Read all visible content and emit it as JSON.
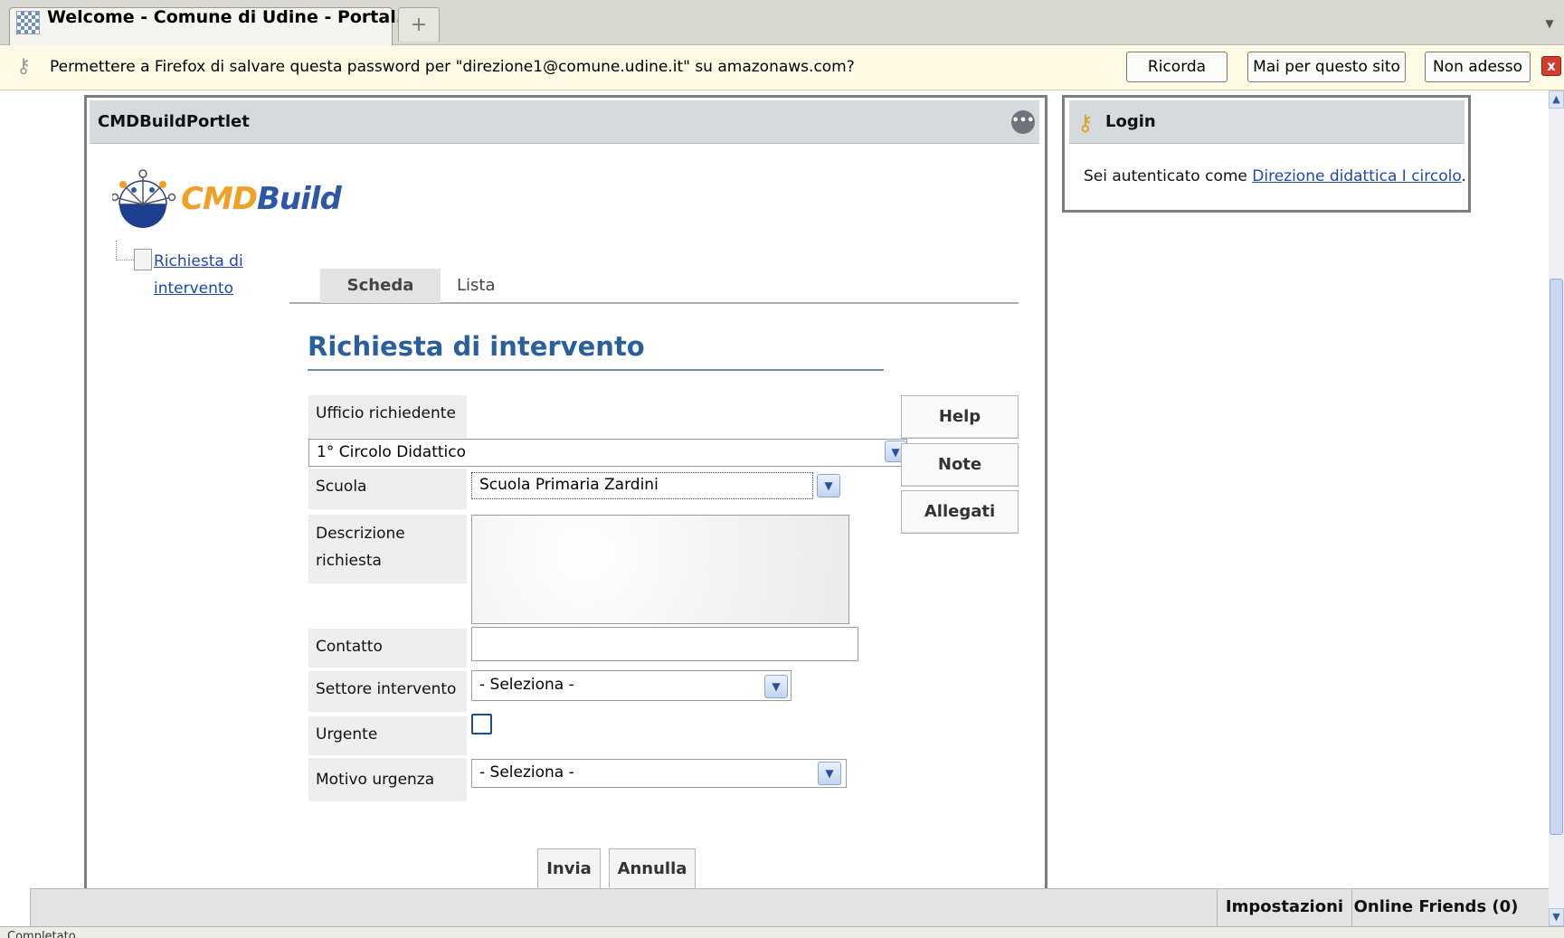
{
  "browser": {
    "tab_title": "Welcome - Comune di Udine - Portal...",
    "new_tab_symbol": "+",
    "notification": {
      "text": "Permettere a Firefox di salvare questa password per \"direzione1@comune.udine.it\" su amazonaws.com?",
      "buttons": [
        "Ricorda",
        "Mai per questo sito",
        "Non adesso"
      ],
      "close_symbol": "x"
    },
    "status_text": "Completato"
  },
  "cmdbuild_portlet": {
    "title": "CMDBuildPortlet",
    "logo_part1": "CMD",
    "logo_part2": "Build",
    "tree_item": "Richiesta di intervento",
    "tabs": [
      "Scheda",
      "Lista"
    ],
    "active_tab": "Scheda",
    "form": {
      "title": "Richiesta di intervento",
      "ufficio_label": "Ufficio richiedente",
      "ufficio_value": "1° Circolo Didattico",
      "scuola_label": "Scuola",
      "scuola_value": "Scuola Primaria Zardini",
      "descrizione_label": "Descrizione richiesta",
      "descrizione_value": "",
      "contatto_label": "Contatto",
      "contatto_value": "",
      "settore_label": "Settore intervento",
      "settore_value": "- Seleziona -",
      "urgente_label": "Urgente",
      "urgente_checked": false,
      "motivo_label": "Motivo urgenza",
      "motivo_value": "- Seleziona -"
    },
    "side_buttons": [
      "Help",
      "Note",
      "Allegati"
    ],
    "footer_buttons": [
      "Invia",
      "Annulla"
    ]
  },
  "login_portlet": {
    "title": "Login",
    "text_prefix": "Sei autenticato come ",
    "user_link": "Direzione didattica I circolo",
    "text_suffix": "."
  },
  "dockbar": {
    "settings": "Impostazioni",
    "friends": "Online Friends (0)"
  },
  "colors": {
    "form_title": "#2a5f9e",
    "link": "#1f47ac",
    "logo_orange": "#f0a024",
    "logo_blue": "#2d58a6"
  }
}
